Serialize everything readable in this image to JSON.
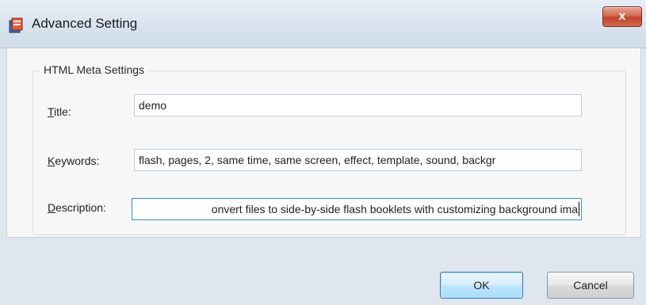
{
  "window": {
    "title": "Advanced Setting",
    "close_label": "x"
  },
  "group": {
    "legend": "HTML Meta Settings"
  },
  "fields": {
    "title": {
      "label": "Title:",
      "accel": "T",
      "rest": "itle:",
      "value": "demo"
    },
    "keywords": {
      "label": "Keywords:",
      "accel": "K",
      "rest": "eywords:",
      "value": "flash, pages, 2, same time, same screen, effect, template, sound, backgr"
    },
    "description": {
      "label": "Description:",
      "accel": "D",
      "rest": "escription:",
      "value": "onvert files to side-by-side flash booklets with customizing background ima"
    }
  },
  "buttons": {
    "ok_label": "OK",
    "cancel_label": "Cancel"
  }
}
